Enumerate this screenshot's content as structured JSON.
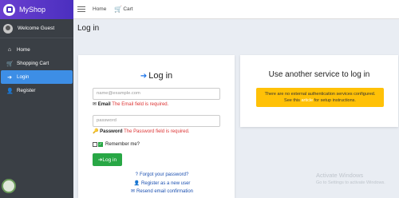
{
  "brand": {
    "name": "MyShop"
  },
  "user": {
    "greeting": "Welcome Guest"
  },
  "sidebar": {
    "items": [
      {
        "label": "Home",
        "icon": "house-icon",
        "glyph": "⌂"
      },
      {
        "label": "Shopping Cart",
        "icon": "cart-icon",
        "glyph": "🛒"
      },
      {
        "label": "Login",
        "icon": "login-icon",
        "glyph": "➔"
      },
      {
        "label": "Register",
        "icon": "user-plus-icon",
        "glyph": "👤"
      }
    ]
  },
  "topbar": {
    "home_label": "Home",
    "cart_label": "Cart"
  },
  "page": {
    "title": "Log in"
  },
  "login": {
    "heading": "Log in",
    "email_placeholder": "name@example.com",
    "email_label": "Email",
    "email_error": "The Email field is required.",
    "password_placeholder": "password",
    "password_label": "Password",
    "password_error": "The Password field is required.",
    "remember_label": "Remember me?",
    "button_label": "Log in",
    "forgot_label": "Forgot your password?",
    "register_label": "Register as a new user",
    "resend_label": "Resend email confirmation"
  },
  "external": {
    "title": "Use another service to log in",
    "notice_line1": "There are no external authentication services configured.",
    "notice_pre": "See this",
    "notice_link": "article",
    "notice_post": "for setup instructions."
  },
  "watermark": {
    "title": "Activate Windows",
    "subtitle": "Go to Settings to activate Windows."
  },
  "colors": {
    "brand_gradient_start": "#6a3fd0",
    "sidebar_bg": "#3a3f45",
    "active_item": "#3d8ee6",
    "success": "#28a745",
    "warning": "#ffc107",
    "error": "#dd3333"
  }
}
